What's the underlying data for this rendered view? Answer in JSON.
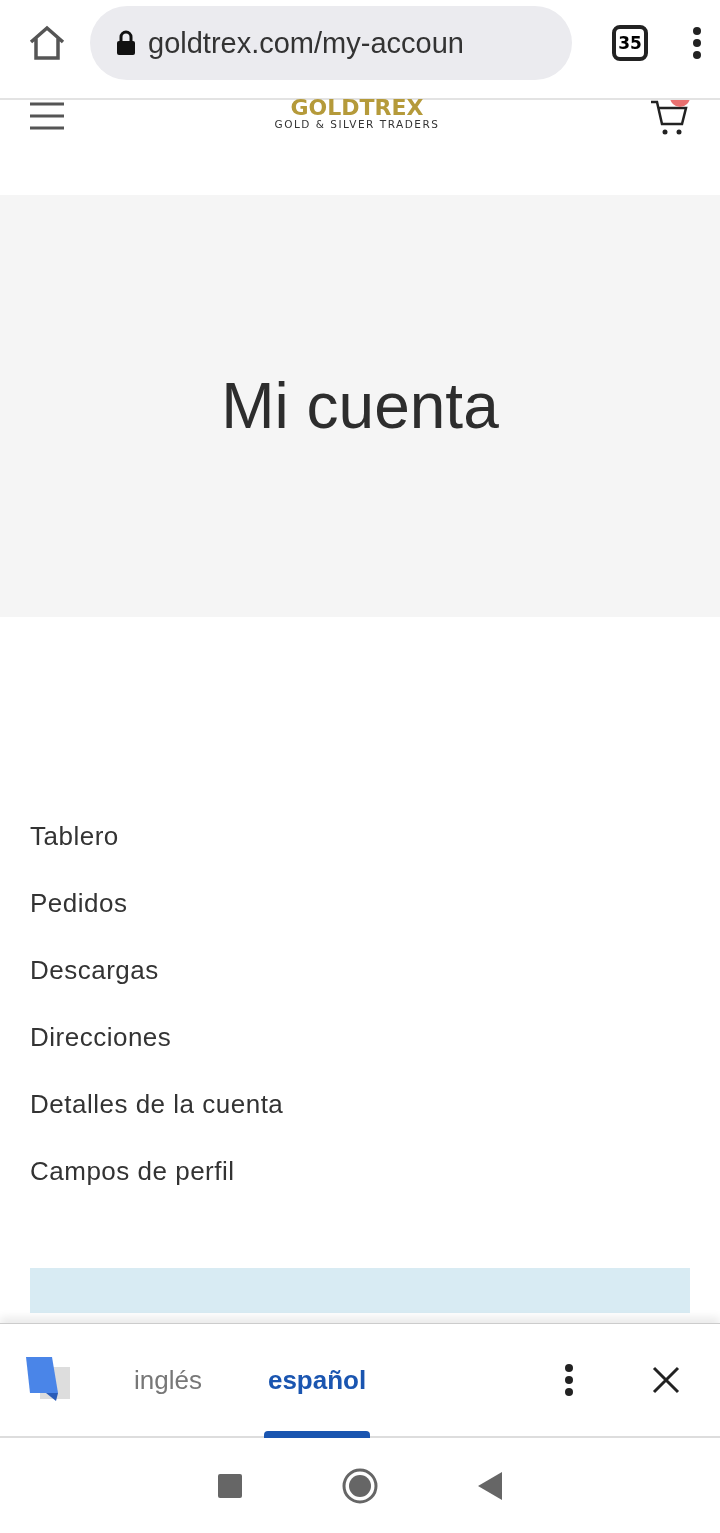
{
  "browser": {
    "url": "goldtrex.com/my-accoun",
    "tab_count": "35"
  },
  "header": {
    "logo": {
      "wordmark": "GOLDTREX",
      "tagline": "GOLD & SILVER TRADERS"
    },
    "cart_badge": true
  },
  "hero": {
    "title": "Mi cuenta"
  },
  "account_menu": [
    {
      "label": "Tablero"
    },
    {
      "label": "Pedidos"
    },
    {
      "label": "Descargas"
    },
    {
      "label": "Direcciones"
    },
    {
      "label": "Detalles de la cuenta"
    },
    {
      "label": "Campos de perfil"
    }
  ],
  "notice": {
    "kind": "info"
  },
  "translate_bar": {
    "languages": [
      {
        "label": "inglés",
        "selected": false
      },
      {
        "label": "español",
        "selected": true
      }
    ]
  }
}
